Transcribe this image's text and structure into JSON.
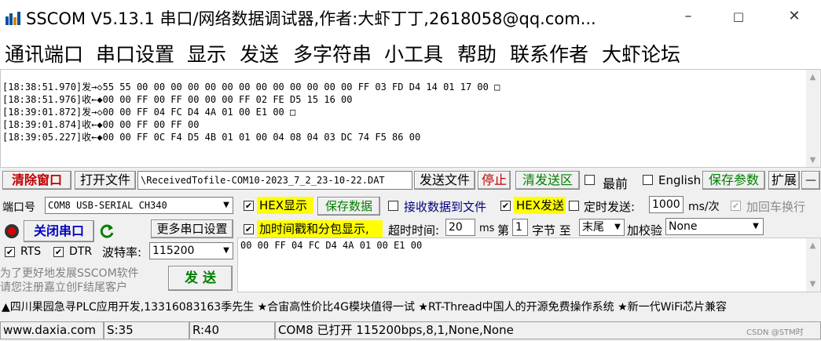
{
  "titlebar": {
    "title": "SSCOM V5.13.1 串口/网络数据调试器,作者:大虾丁丁,2618058@qq.com...",
    "minimize": "–",
    "maximize": "□",
    "close": "✕"
  },
  "menu": [
    "通讯端口",
    "串口设置",
    "显示",
    "发送",
    "多字符串",
    "小工具",
    "帮助",
    "联系作者",
    "大虾论坛"
  ],
  "log": [
    "[18:38:51.970]发→◇55 55 00 00 00 00 00 00 00 00 00 00 00 00 00 FF 03 FD D4 14 01 17 00 □",
    "[18:38:51.976]收←◆00 00 FF 00 FF 00 00 00 FF 02 FE D5 15 16 00",
    "[18:39:01.872]发→◇00 00 FF 04 FC D4 4A 01 00 E1 00 □",
    "[18:39:01.874]收←◆00 00 FF 00 FF 00",
    "[18:39:05.227]收←◆00 00 FF 0C F4 D5 4B 01 01 00 04 08 04 03 DC 74 F5 86 00"
  ],
  "toolbar": {
    "clear": "清除窗口",
    "open_file": "打开文件",
    "file_path": "\\ReceivedTofile-COM10-2023_7_2_23-10-22.DAT",
    "send_file": "发送文件",
    "stop": "停止",
    "clear_send": "清发送区",
    "topmost": "最前",
    "english": "English",
    "save_params": "保存参数",
    "expand": "扩展",
    "collapse": "—"
  },
  "port": {
    "port_label": "端口号",
    "port_value": "COM8 USB-SERIAL CH340",
    "close_port": "关闭串口",
    "more_settings": "更多串口设置",
    "rts": "RTS",
    "dtr": "DTR",
    "baud_label": "波特率:",
    "baud_value": "115200",
    "promo1": "为了更好地发展SSCOM软件",
    "promo2": "请您注册嘉立创F结尾客户",
    "send": "发 送"
  },
  "options": {
    "hex_display": "HEX显示",
    "save_data": "保存数据",
    "recv_to_file": "接收数据到文件",
    "hex_send": "HEX发送",
    "timed_send": "定时发送:",
    "interval": "1000",
    "interval_unit": "ms/次",
    "add_crlf": "加回车换行",
    "timestamp": "加时间戳和分包显示,",
    "timeout_label": "超时时间:",
    "timeout_value": "20",
    "ms": "ms",
    "nth": "第",
    "byte_index": "1",
    "byte_to": "字节 至",
    "end_value": "末尾",
    "checksum_label": "加校验",
    "checksum_value": "None"
  },
  "send_content": "00 00 FF 04 FC D4 4A 01 00 E1 00",
  "ticker": "▲四川果园急寻PLC应用开发,13316083163季先生 ★合宙高性价比4G模块值得一试 ★RT-Thread中国人的开源免费操作系统 ★新一代WiFi芯片兼容",
  "status": {
    "site": "www.daxia.com",
    "sent": "S:35",
    "received": "R:40",
    "port_state": "COM8 已打开  115200bps,8,1,None,None",
    "watermark": "CSDN @STM时"
  },
  "colors": {
    "clear_red": "#c00000",
    "green_text": "#008000",
    "highlight": "#ffff00",
    "close_port_icon": "#cc0000"
  }
}
